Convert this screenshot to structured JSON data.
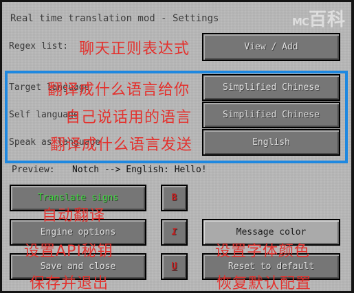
{
  "title": "Real time translation mod - Settings",
  "watermark": {
    "mc": "MC",
    "text": "百科"
  },
  "regex": {
    "label": "Regex list:",
    "button": "View / Add"
  },
  "target_language": {
    "label": "Target language",
    "value": "Simplified Chinese"
  },
  "self_language": {
    "label": "Self language",
    "value": "Simplified Chinese"
  },
  "speak_as_language": {
    "label": "Speak as language",
    "value": "English"
  },
  "preview": {
    "label": "Preview:",
    "text": "Notch --> English: Hello!"
  },
  "buttons": {
    "translate_signs": "Translate signs",
    "engine_options": "Engine options",
    "save_and_close": "Save and close",
    "bold": "B",
    "italic": "I",
    "underline": "U",
    "message_color": "Message color",
    "reset_to_default": "Reset to default"
  },
  "annotations": {
    "regex": "聊天正则表达式",
    "target": "翻译成什么语言给你",
    "self": "自己说话用的语言",
    "speak": "翻译成什么语言发送",
    "auto": "自动翻译",
    "api": "设置API秘钥",
    "save": "保存并退出",
    "font_color": "设置字体颜色",
    "reset": "恢复默认配置"
  },
  "colors": {
    "highlight_border": "#1e88e0",
    "annotation": "#e3322e",
    "translate_signs_text": "#3ae33a",
    "style_letters": "#c81e1e"
  }
}
